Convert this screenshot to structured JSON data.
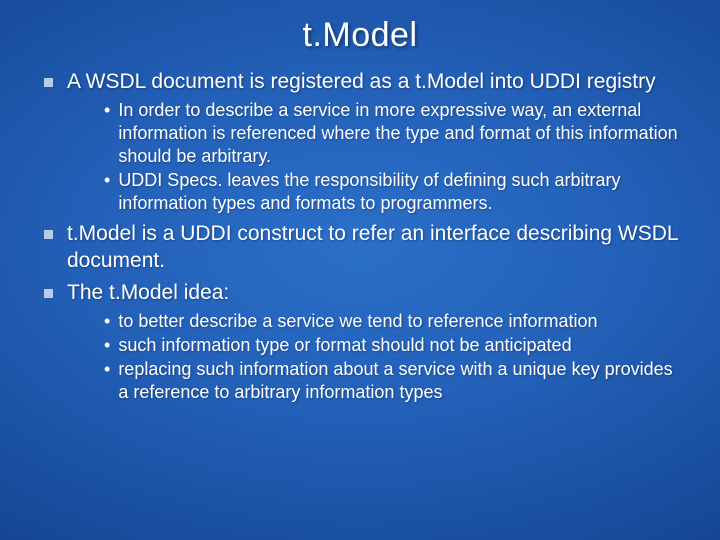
{
  "title": "t.Model",
  "items": [
    {
      "text": "A WSDL document is registered as a t.Model into UDDI registry",
      "sub": [
        "In order to describe a service in more expressive way, an external information is referenced where the type and format of this information should be arbitrary.",
        "UDDI Specs. leaves the responsibility of defining such arbitrary information types and formats to programmers."
      ]
    },
    {
      "text": "t.Model is a UDDI construct to refer an interface describing WSDL document.",
      "sub": []
    },
    {
      "text": "The t.Model idea:",
      "sub": [
        "to better describe a service we tend to reference information",
        "such information type or format should not be anticipated",
        "replacing such information about a service with a unique key provides a  reference to arbitrary information types"
      ]
    }
  ]
}
